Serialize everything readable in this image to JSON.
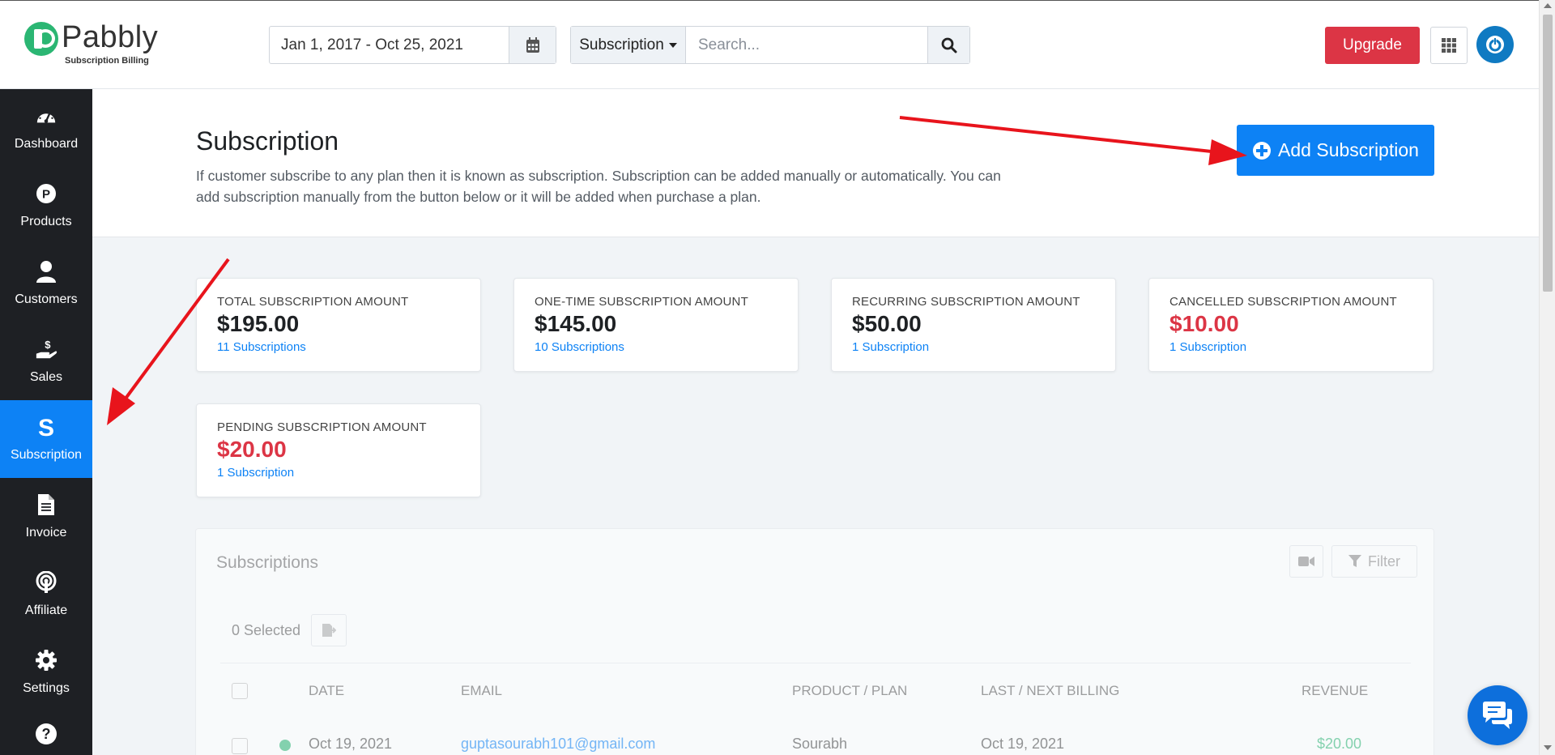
{
  "brand": {
    "name": "Pabbly",
    "tagline": "Subscription Billing",
    "color": "#2bb673"
  },
  "topbar": {
    "date_range": "Jan 1, 2017 - Oct 25, 2021",
    "search_type": "Subscription",
    "search_placeholder": "Search...",
    "upgrade_label": "Upgrade",
    "upgrade_color": "#dc3545"
  },
  "sidebar": {
    "accent": "#0d82f5",
    "items": [
      {
        "label": "Dashboard",
        "icon": "speedometer-icon"
      },
      {
        "label": "Products",
        "icon": "p-circle-icon"
      },
      {
        "label": "Customers",
        "icon": "user-icon"
      },
      {
        "label": "Sales",
        "icon": "hand-dollar-icon"
      },
      {
        "label": "Subscription",
        "icon": "s-letter-icon",
        "active": true
      },
      {
        "label": "Invoice",
        "icon": "document-icon"
      },
      {
        "label": "Affiliate",
        "icon": "broadcast-icon"
      },
      {
        "label": "Settings",
        "icon": "gear-icon"
      },
      {
        "label": "",
        "icon": "help-icon"
      }
    ]
  },
  "header": {
    "title": "Subscription",
    "description": "If customer subscribe to any plan then it is known as subscription. Subscription can be added manually or automatically. You can add subscription manually from the button below or it will be added when purchase a plan.",
    "add_button": "Add Subscription"
  },
  "stats": [
    {
      "label": "TOTAL SUBSCRIPTION AMOUNT",
      "value": "$195.00",
      "link": "11 Subscriptions",
      "red": false
    },
    {
      "label": "ONE-TIME SUBSCRIPTION AMOUNT",
      "value": "$145.00",
      "link": "10 Subscriptions",
      "red": false
    },
    {
      "label": "RECURRING SUBSCRIPTION AMOUNT",
      "value": "$50.00",
      "link": "1 Subscription",
      "red": false
    },
    {
      "label": "CANCELLED SUBSCRIPTION AMOUNT",
      "value": "$10.00",
      "link": "1 Subscription",
      "red": true
    },
    {
      "label": "PENDING SUBSCRIPTION AMOUNT",
      "value": "$20.00",
      "link": "1 Subscription",
      "red": true
    }
  ],
  "table": {
    "title": "Subscriptions",
    "filter_label": "Filter",
    "selected_label": "0 Selected",
    "columns": [
      "DATE",
      "EMAIL",
      "PRODUCT / PLAN",
      "LAST / NEXT BILLING",
      "REVENUE"
    ],
    "rows": [
      {
        "date": "Oct 19, 2021",
        "email": "guptasourabh101@gmail.com",
        "product": "Sourabh",
        "billing": "Oct 19, 2021",
        "revenue": "$20.00"
      }
    ]
  },
  "annotation": {
    "arrow_color": "#e8141c"
  }
}
